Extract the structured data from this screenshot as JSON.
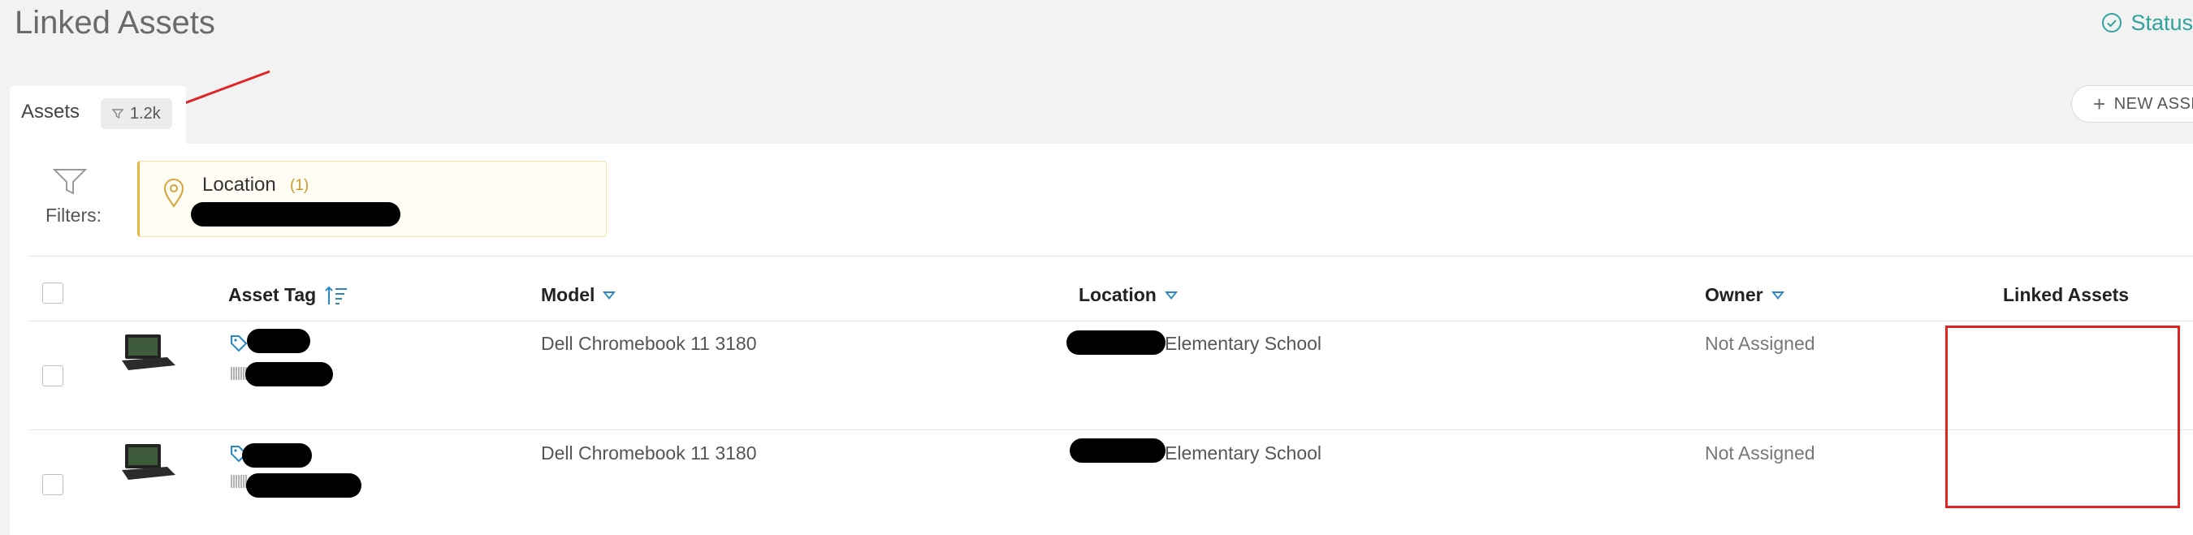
{
  "header": {
    "title": "Linked Assets",
    "status_label": "Status"
  },
  "tabs": {
    "assets_label": "Assets",
    "assets_count": "1.2k"
  },
  "actions": {
    "new_asset_label": "NEW ASSE"
  },
  "filters": {
    "label": "Filters:",
    "location": {
      "title": "Location",
      "count": "(1)"
    }
  },
  "table": {
    "columns": {
      "asset_tag": "Asset Tag",
      "model": "Model",
      "location": "Location",
      "owner": "Owner",
      "linked_assets": "Linked Assets"
    },
    "rows": [
      {
        "model": "Dell Chromebook 11 3180",
        "location_suffix": "Elementary School",
        "owner": "Not Assigned"
      },
      {
        "model": "Dell Chromebook 11 3180",
        "location_suffix": "Elementary School",
        "owner": "Not Assigned"
      }
    ]
  },
  "colors": {
    "accent_teal": "#2fa39a",
    "accent_blue": "#2b86c5",
    "filter_yellow": "#e6b944",
    "annotation_red": "#e02424"
  },
  "icons": [
    "check-circle-icon",
    "filter-icon",
    "plus-icon",
    "map-pin-icon",
    "sort-ascending-icon",
    "tag-icon",
    "barcode-icon",
    "laptop-thumbnail"
  ]
}
